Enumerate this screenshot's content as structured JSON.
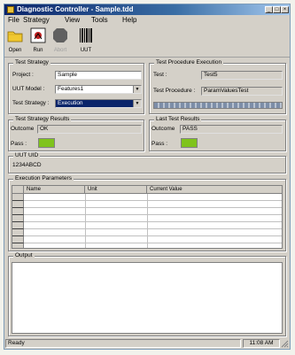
{
  "window": {
    "title": "Diagnostic Controller - Sample.tdd"
  },
  "menu": [
    "File",
    "Strategy",
    "View",
    "Tools",
    "Help"
  ],
  "toolbar": {
    "open_label": "Open",
    "run_label": "Run",
    "abort_label": "Abort",
    "uut_label": "UUT"
  },
  "test_strategy": {
    "title": "Test Strategy",
    "project_label": "Project :",
    "project_value": "Sample",
    "uut_model_label": "UUT Model :",
    "uut_model_value": "Features1",
    "strategy_label": "Test Strategy :",
    "strategy_value": "Execution"
  },
  "test_procedure_execution": {
    "title": "Test Procedure Execution",
    "test_label": "Test :",
    "test_value": "Test5",
    "procedure_label": "Test Procedure :",
    "procedure_value": "ParamValuesTest"
  },
  "strategy_results": {
    "title": "Test Strategy Results",
    "outcome_label": "Outcome",
    "outcome_value": "OK",
    "pass_label": "Pass :",
    "pass_color": "#7fc31c"
  },
  "last_test_results": {
    "title": "Last Test Results",
    "outcome_label": "Outcome",
    "outcome_value": "PASS",
    "pass_label": "Pass :",
    "pass_color": "#7fc31c"
  },
  "uut_uid": {
    "title": "UUT UID",
    "value": "1234ABCD"
  },
  "execution_parameters": {
    "title": "Execution Parameters",
    "columns": [
      "Name",
      "Unit",
      "Current Value"
    ]
  },
  "output": {
    "title": "Output"
  },
  "status": {
    "text": "Ready",
    "time": "11:08 AM"
  }
}
